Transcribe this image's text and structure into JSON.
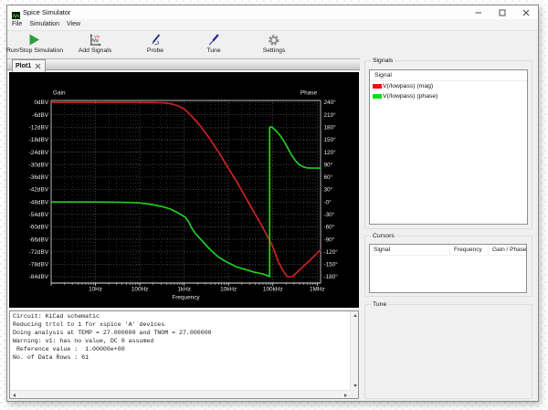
{
  "window": {
    "title": "Spice Simulator",
    "controls": {
      "minimize": "minimize",
      "maximize": "maximize",
      "close": "close"
    }
  },
  "menu": {
    "items": [
      {
        "label": "File"
      },
      {
        "label": "Simulation"
      },
      {
        "label": "View"
      }
    ]
  },
  "toolbar": {
    "buttons": [
      {
        "label": "Run/Stop Simulation",
        "icon": "run-icon"
      },
      {
        "label": "Add Signals",
        "icon": "add-signals-icon"
      },
      {
        "label": "Probe",
        "icon": "probe-icon"
      },
      {
        "label": "Tune",
        "icon": "tune-icon"
      },
      {
        "label": "Settings",
        "icon": "settings-icon"
      }
    ]
  },
  "tabs": [
    {
      "label": "Plot1",
      "active": true
    }
  ],
  "chart_data": {
    "type": "line",
    "background": "#000000",
    "grid": true,
    "x_axis": {
      "label": "Frequency",
      "scale": "log",
      "ticks": [
        "10Hz",
        "100Hz",
        "1kHz",
        "10kHz",
        "100kHz",
        "1MHz"
      ],
      "tick_values": [
        10,
        100,
        1000,
        10000,
        100000,
        1000000
      ],
      "range": [
        1,
        1180000
      ]
    },
    "y_axis_left": {
      "label": "Gain",
      "ticks": [
        "0dBV",
        "-6dBV",
        "-12dBV",
        "-18dBV",
        "-24dBV",
        "-30dBV",
        "-36dBV",
        "-42dBV",
        "-48dBV",
        "-54dBV",
        "-60dBV",
        "-66dBV",
        "-72dBV",
        "-78dBV",
        "-84dBV"
      ],
      "tick_values": [
        0,
        -6,
        -12,
        -18,
        -24,
        -30,
        -36,
        -42,
        -48,
        -54,
        -60,
        -66,
        -72,
        -78,
        -84
      ]
    },
    "y_axis_right": {
      "label": "Phase",
      "ticks": [
        "240°",
        "210°",
        "180°",
        "150°",
        "120°",
        "90°",
        "60°",
        "30°",
        "-0°",
        "-30°",
        "-60°",
        "-90°",
        "-120°",
        "-150°",
        "-180°"
      ],
      "tick_values": [
        240,
        210,
        180,
        150,
        120,
        90,
        60,
        30,
        0,
        -30,
        -60,
        -90,
        -120,
        -150,
        -180
      ]
    },
    "series": [
      {
        "name": "V(/lowpass) (mag)",
        "axis": "gain",
        "color": "#cc2222",
        "points": [
          [
            1,
            0
          ],
          [
            3,
            0
          ],
          [
            10,
            0
          ],
          [
            30,
            0
          ],
          [
            100,
            -0.02
          ],
          [
            200,
            -0.1
          ],
          [
            316,
            -0.25
          ],
          [
            500,
            -0.7
          ],
          [
            700,
            -1.6
          ],
          [
            1000,
            -3.2
          ],
          [
            1470,
            -6.6
          ],
          [
            2340,
            -11.5
          ],
          [
            3720,
            -17.4
          ],
          [
            5900,
            -23.8
          ],
          [
            9400,
            -30.9
          ],
          [
            14900,
            -37.8
          ],
          [
            23700,
            -45.4
          ],
          [
            37600,
            -52.9
          ],
          [
            59700,
            -60.4
          ],
          [
            95000,
            -68.6
          ],
          [
            105000,
            -70.8
          ],
          [
            133000,
            -77.0
          ],
          [
            168000,
            -80.9
          ],
          [
            207000,
            -83.8
          ],
          [
            240000,
            -84.2
          ],
          [
            283000,
            -83.8
          ],
          [
            360000,
            -81.7
          ],
          [
            434000,
            -80.0
          ],
          [
            552000,
            -78.0
          ],
          [
            697000,
            -75.9
          ],
          [
            879000,
            -73.8
          ],
          [
            1060000,
            -72.1
          ],
          [
            1180000,
            -71.2
          ]
        ]
      },
      {
        "name": "V(/lowpass) (phase)",
        "axis": "phase",
        "color": "#22cc22",
        "points": [
          [
            1,
            -0.2
          ],
          [
            10,
            -0.3
          ],
          [
            30,
            -0.6
          ],
          [
            65,
            -1.5
          ],
          [
            100,
            -2.6
          ],
          [
            166,
            -5.2
          ],
          [
            333,
            -11.6
          ],
          [
            500,
            -17.5
          ],
          [
            671,
            -24.5
          ],
          [
            900,
            -32
          ],
          [
            1070,
            -37.5
          ],
          [
            1250,
            -47
          ],
          [
            1470,
            -62.3
          ],
          [
            1800,
            -76
          ],
          [
            2340,
            -89.4
          ],
          [
            3000,
            -102
          ],
          [
            3720,
            -112.9
          ],
          [
            4700,
            -123
          ],
          [
            5900,
            -132.5
          ],
          [
            7500,
            -139.5
          ],
          [
            9400,
            -145.4
          ],
          [
            12000,
            -151
          ],
          [
            14900,
            -156.2
          ],
          [
            19000,
            -159.6
          ],
          [
            23700,
            -162.6
          ],
          [
            30000,
            -165.9
          ],
          [
            37600,
            -169.0
          ],
          [
            48000,
            -171.4
          ],
          [
            59700,
            -173.4
          ],
          [
            72000,
            -176.7
          ],
          [
            80000,
            -178.5
          ],
          [
            84500,
            -180
          ],
          [
            84500,
            180
          ],
          [
            88000,
            180.4
          ],
          [
            95000,
            180.2
          ],
          [
            100000,
            178.5
          ],
          [
            106000,
            176
          ],
          [
            127000,
            167.7
          ],
          [
            153000,
            157.1
          ],
          [
            185000,
            143.0
          ],
          [
            224000,
            127.2
          ],
          [
            270000,
            111.3
          ],
          [
            326000,
            98.9
          ],
          [
            394000,
            90.0
          ],
          [
            476000,
            84.8
          ],
          [
            575000,
            82.3
          ],
          [
            695000,
            81.6
          ],
          [
            900000,
            81.5
          ],
          [
            1180000,
            81.6
          ]
        ]
      }
    ]
  },
  "signals_panel": {
    "title": "Signals",
    "column_header": "Signal",
    "rows": [
      {
        "label": "V(/lowpass) (mag)",
        "color": "#ee1111"
      },
      {
        "label": "V(/lowpass) (phase)",
        "color": "#11dd11"
      }
    ]
  },
  "cursors_panel": {
    "title": "Cursors",
    "columns": [
      "Signal",
      "Frequency",
      "Gain / Phase"
    ]
  },
  "tune_panel": {
    "title": "Tune"
  },
  "console": {
    "lines": [
      "Circuit: KiCad schematic",
      "Reducing trtol to 1 for xspice 'A' devices",
      "Doing analysis at TEMP = 27.000000 and TNOM = 27.000000",
      "Warning: v1: has no value, DC 0 assumed",
      " Reference value :  1.00000e+00",
      "No. of Data Rows : 61"
    ]
  }
}
